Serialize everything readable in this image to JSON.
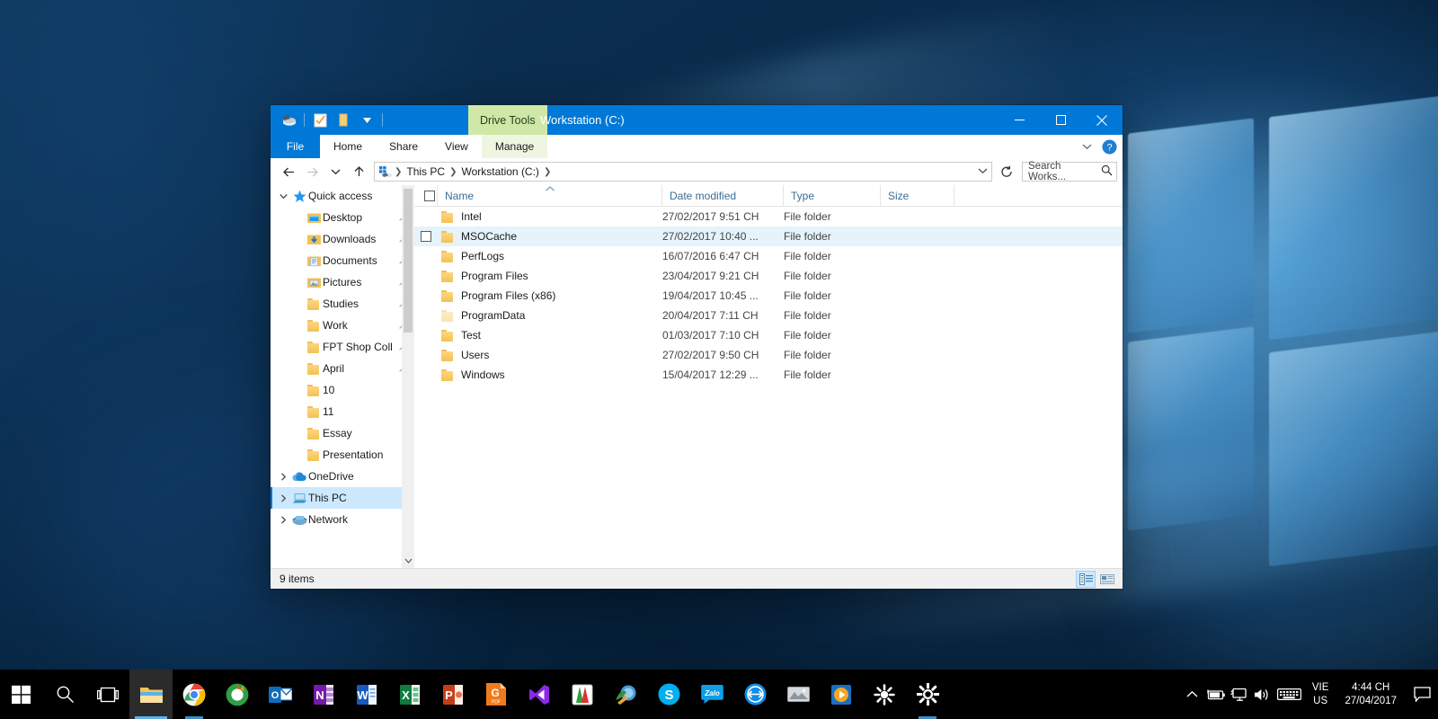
{
  "window": {
    "title": "Workstation (C:)",
    "contextual_tab": "Drive Tools",
    "quick_access_icons": [
      "drive-icon",
      "properties-icon",
      "new-folder-icon",
      "customize-chevron-icon"
    ],
    "buttons": {
      "minimize": "minimize-icon",
      "maximize": "maximize-icon",
      "close": "close-icon"
    }
  },
  "ribbon": {
    "file_tab": "File",
    "tabs": [
      "Home",
      "Share",
      "View",
      "Manage"
    ],
    "collapse_icon": "chevron-down-icon",
    "help_icon": "help-icon"
  },
  "address": {
    "back": "back-arrow-icon",
    "forward": "forward-arrow-icon",
    "recent": "chevron-down-icon",
    "up": "up-arrow-icon",
    "crumbs": [
      "This PC",
      "Workstation (C:)"
    ],
    "refresh": "refresh-icon",
    "dropdown": "chevron-down-icon"
  },
  "search": {
    "placeholder": "Search Works...",
    "icon": "search-icon"
  },
  "navpane": {
    "items": [
      {
        "label": "Quick access",
        "icon": "star-icon",
        "indent": 0,
        "expander": "chevron-down",
        "pinned": false,
        "selected": false
      },
      {
        "label": "Desktop",
        "icon": "desktop-folder-icon",
        "indent": 1,
        "expander": "",
        "pinned": true,
        "selected": false
      },
      {
        "label": "Downloads",
        "icon": "downloads-folder-icon",
        "indent": 1,
        "expander": "",
        "pinned": true,
        "selected": false
      },
      {
        "label": "Documents",
        "icon": "documents-folder-icon",
        "indent": 1,
        "expander": "",
        "pinned": true,
        "selected": false
      },
      {
        "label": "Pictures",
        "icon": "pictures-folder-icon",
        "indent": 1,
        "expander": "",
        "pinned": true,
        "selected": false
      },
      {
        "label": "Studies",
        "icon": "folder-icon",
        "indent": 1,
        "expander": "",
        "pinned": true,
        "selected": false
      },
      {
        "label": "Work",
        "icon": "folder-icon",
        "indent": 1,
        "expander": "",
        "pinned": true,
        "selected": false
      },
      {
        "label": "FPT Shop Coll",
        "icon": "folder-icon",
        "indent": 1,
        "expander": "",
        "pinned": true,
        "selected": false
      },
      {
        "label": "April",
        "icon": "folder-icon",
        "indent": 1,
        "expander": "",
        "pinned": true,
        "selected": false
      },
      {
        "label": "10",
        "icon": "folder-icon",
        "indent": 1,
        "expander": "",
        "pinned": false,
        "selected": false
      },
      {
        "label": "11",
        "icon": "folder-icon",
        "indent": 1,
        "expander": "",
        "pinned": false,
        "selected": false
      },
      {
        "label": "Essay",
        "icon": "folder-icon",
        "indent": 1,
        "expander": "",
        "pinned": false,
        "selected": false
      },
      {
        "label": "Presentation",
        "icon": "folder-icon",
        "indent": 1,
        "expander": "",
        "pinned": false,
        "selected": false
      },
      {
        "label": "OneDrive",
        "icon": "cloud-icon",
        "indent": 0,
        "expander": "chevron-right",
        "pinned": false,
        "selected": false
      },
      {
        "label": "This PC",
        "icon": "computer-icon",
        "indent": 0,
        "expander": "chevron-right",
        "pinned": false,
        "selected": true
      },
      {
        "label": "Network",
        "icon": "network-icon",
        "indent": 0,
        "expander": "chevron-right",
        "pinned": false,
        "selected": false
      }
    ]
  },
  "filelist": {
    "columns": [
      "Name",
      "Date modified",
      "Type",
      "Size"
    ],
    "select_all": "select-all-checkbox",
    "sort_column": "Name",
    "sort_direction": "ascending",
    "rows": [
      {
        "name": "Intel",
        "date": "27/02/2017 9:51 CH",
        "type": "File folder",
        "size": "",
        "hovered": false,
        "dimmed": false
      },
      {
        "name": "MSOCache",
        "date": "27/02/2017 10:40 ...",
        "type": "File folder",
        "size": "",
        "hovered": true,
        "dimmed": false
      },
      {
        "name": "PerfLogs",
        "date": "16/07/2016 6:47 CH",
        "type": "File folder",
        "size": "",
        "hovered": false,
        "dimmed": false
      },
      {
        "name": "Program Files",
        "date": "23/04/2017 9:21 CH",
        "type": "File folder",
        "size": "",
        "hovered": false,
        "dimmed": false
      },
      {
        "name": "Program Files (x86)",
        "date": "19/04/2017 10:45 ...",
        "type": "File folder",
        "size": "",
        "hovered": false,
        "dimmed": false
      },
      {
        "name": "ProgramData",
        "date": "20/04/2017 7:11 CH",
        "type": "File folder",
        "size": "",
        "hovered": false,
        "dimmed": true
      },
      {
        "name": "Test",
        "date": "01/03/2017 7:10 CH",
        "type": "File folder",
        "size": "",
        "hovered": false,
        "dimmed": false
      },
      {
        "name": "Users",
        "date": "27/02/2017 9:50 CH",
        "type": "File folder",
        "size": "",
        "hovered": false,
        "dimmed": false
      },
      {
        "name": "Windows",
        "date": "15/04/2017 12:29 ...",
        "type": "File folder",
        "size": "",
        "hovered": false,
        "dimmed": false
      }
    ]
  },
  "statusbar": {
    "item_count": "9 items",
    "details_view_icon": "details-view-icon",
    "large_icons_view_icon": "large-icons-view-icon",
    "active_view": "details"
  },
  "taskbar": {
    "start": "windows-start-icon",
    "search": "search-icon",
    "task_view": "task-view-icon",
    "apps": [
      {
        "name": "file-explorer",
        "glyph": "",
        "running": true
      },
      {
        "name": "google-chrome",
        "glyph": "",
        "running": true
      },
      {
        "name": "coc-coc-browser",
        "glyph": "",
        "running": false
      },
      {
        "name": "outlook",
        "glyph": "O",
        "running": false
      },
      {
        "name": "onenote",
        "glyph": "N",
        "running": false
      },
      {
        "name": "word",
        "glyph": "W",
        "running": false
      },
      {
        "name": "excel",
        "glyph": "X",
        "running": false
      },
      {
        "name": "powerpoint",
        "glyph": "P",
        "running": false
      },
      {
        "name": "foxit-pdf-reader",
        "glyph": "G",
        "running": false
      },
      {
        "name": "visual-studio",
        "glyph": "",
        "running": false
      },
      {
        "name": "unikey",
        "glyph": "",
        "running": false
      },
      {
        "name": "internet-download-manager",
        "glyph": "",
        "running": false
      },
      {
        "name": "skype",
        "glyph": "S",
        "running": false
      },
      {
        "name": "zalo",
        "glyph": "Zalo",
        "running": false
      },
      {
        "name": "teamviewer",
        "glyph": "",
        "running": false
      },
      {
        "name": "photo-viewer",
        "glyph": "",
        "running": false
      },
      {
        "name": "media-player",
        "glyph": "",
        "running": false
      },
      {
        "name": "settings-gear-white",
        "glyph": "",
        "running": false
      },
      {
        "name": "settings-gear",
        "glyph": "",
        "running": true
      }
    ],
    "tray": {
      "show_hidden": "chevron-up-icon",
      "battery": "battery-icon",
      "network": "network-monitor-icon",
      "volume": "volume-icon",
      "keyboard": "keyboard-icon",
      "language_line1": "VIE",
      "language_line2": "US",
      "time": "4:44 CH",
      "date": "27/04/2017",
      "action_center": "action-center-icon"
    }
  },
  "colors": {
    "accent": "#0078d7",
    "contextual_tab": "#cfe8a8",
    "selection": "#cce8ff",
    "hover": "#e5f3fb",
    "folder": "#f3c253"
  }
}
